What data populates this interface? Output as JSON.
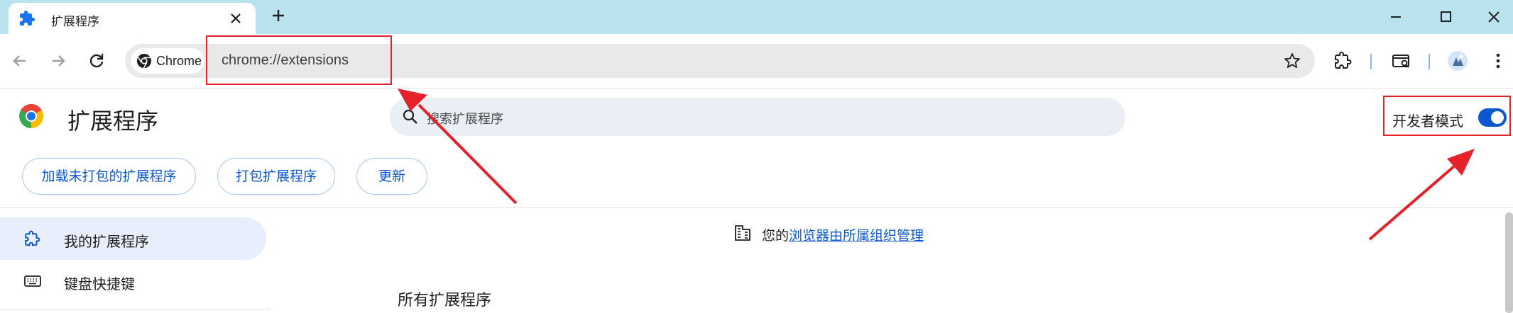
{
  "tab": {
    "title": "扩展程序"
  },
  "omnibox": {
    "chip_label": "Chrome",
    "url": "chrome://extensions"
  },
  "page": {
    "title": "扩展程序"
  },
  "search": {
    "placeholder": "搜索扩展程序"
  },
  "dev_mode": {
    "label": "开发者模式",
    "enabled": true
  },
  "buttons": {
    "load_unpacked": "加载未打包的扩展程序",
    "pack": "打包扩展程序",
    "update": "更新"
  },
  "sidebar": {
    "items": [
      {
        "label": "我的扩展程序",
        "icon": "extension-icon",
        "active": true
      },
      {
        "label": "键盘快捷键",
        "icon": "keyboard-icon",
        "active": false
      }
    ]
  },
  "managed": {
    "prefix": "您的",
    "link": "浏览器由所属组织管理"
  },
  "section": {
    "heading": "所有扩展程序"
  },
  "colors": {
    "tabstrip": "#b8e3ee",
    "accent": "#0b57d0",
    "annotation": "#e5222a"
  }
}
